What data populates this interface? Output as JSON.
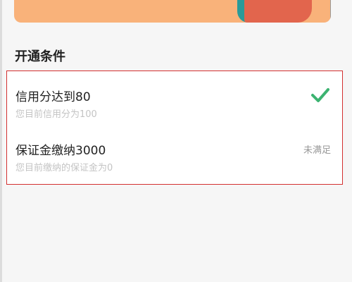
{
  "colors": {
    "accent_check": "#3cb371",
    "highlight_border": "#d32f2f",
    "banner": "#f9b27a"
  },
  "section": {
    "title": "开通条件"
  },
  "conditions": [
    {
      "title": "信用分达到80",
      "subtitle": "您目前信用分为100",
      "status_icon": "check-icon"
    },
    {
      "title": "保证金缴纳3000",
      "subtitle": "您目前缴纳的保证金为0",
      "status_text": "未满足"
    }
  ]
}
